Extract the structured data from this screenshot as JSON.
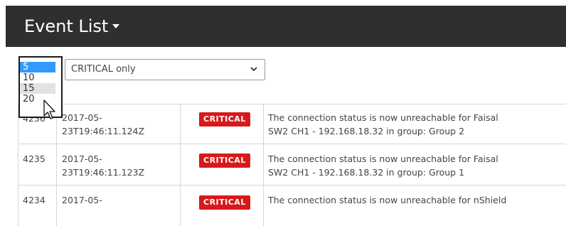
{
  "header": {
    "title": "Event List"
  },
  "filters": {
    "count_options": [
      "5",
      "10",
      "15",
      "20"
    ],
    "count_selected": "5",
    "count_hover": "15",
    "severity_value": "CRITICAL only"
  },
  "rows": [
    {
      "id": "4236",
      "timestamp_line1": "2017-05-",
      "timestamp_line2": "23T19:46:11.124Z",
      "severity": "CRITICAL",
      "message_line1": "The connection status is now unreachable for Faisal",
      "message_line2": "SW2 CH1 - 192.168.18.32 in group: Group 2"
    },
    {
      "id": "4235",
      "timestamp_line1": "2017-05-",
      "timestamp_line2": "23T19:46:11.123Z",
      "severity": "CRITICAL",
      "message_line1": "The connection status is now unreachable for Faisal",
      "message_line2": "SW2 CH1 - 192.168.18.32 in group: Group 1"
    },
    {
      "id": "4234",
      "timestamp_line1": "2017-05-",
      "timestamp_line2": "",
      "severity": "CRITICAL",
      "message_line1": "The connection status is now unreachable for nShield",
      "message_line2": ""
    }
  ],
  "colors": {
    "header_bg": "#2f2f2f",
    "critical_badge": "#d7191c",
    "selected_option": "#3399ff"
  }
}
